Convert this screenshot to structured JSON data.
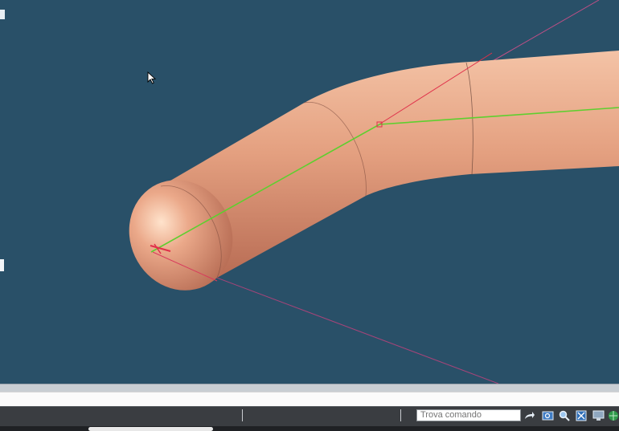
{
  "statusbar": {
    "search_placeholder": "Trova comando"
  },
  "colors": {
    "viewport_bg": "#295068",
    "pipe": "#d98a6e",
    "path_line": "#5ecf2f",
    "axis_red": "#e0304a",
    "axis_magenta": "#c04f86"
  },
  "icons": [
    "pointer-cursor-icon",
    "redo-arrow-icon",
    "zoom-window-icon",
    "zoom-icon",
    "fullscreen-icon",
    "display-icon",
    "globe-icon"
  ]
}
